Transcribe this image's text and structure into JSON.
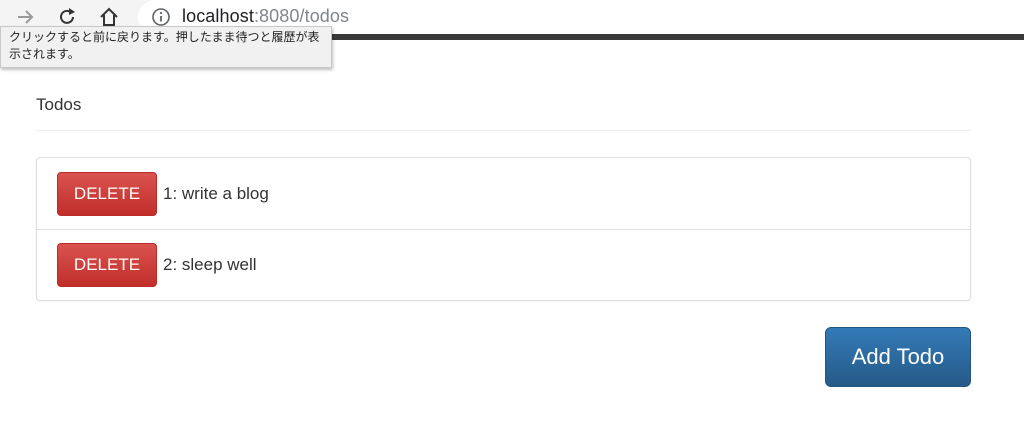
{
  "browser": {
    "url_host": "localhost",
    "url_rest": ":8080/todos",
    "back_tooltip": "クリックすると前に戻ります。押したまま待つと履歴が表示されます。"
  },
  "page": {
    "title": "Todos"
  },
  "todos": [
    {
      "delete_label": "DELETE",
      "text": "1: write a blog"
    },
    {
      "delete_label": "DELETE",
      "text": "2: sleep well"
    }
  ],
  "actions": {
    "add_label": "Add Todo"
  },
  "colors": {
    "danger": "#d9534f",
    "primary": "#337ab7"
  }
}
